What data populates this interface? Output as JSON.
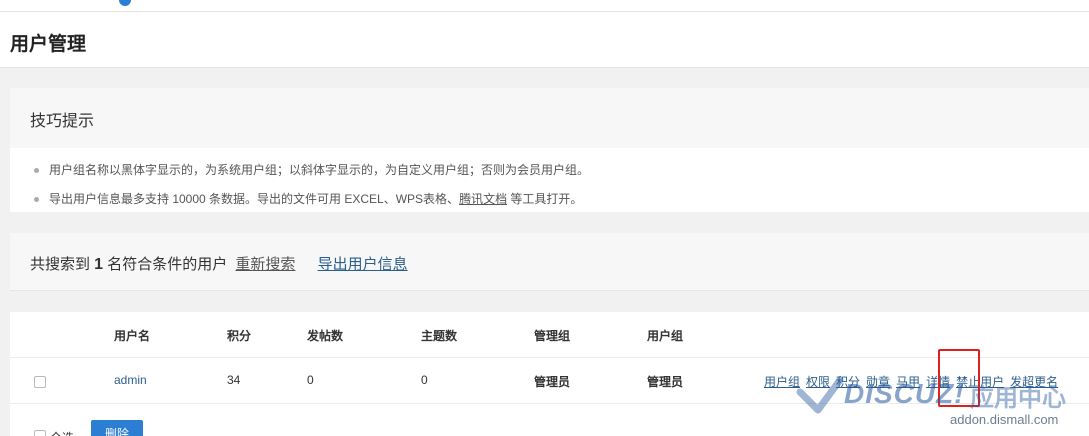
{
  "page": {
    "title": "用户管理"
  },
  "tips": {
    "title": "技巧提示",
    "items": [
      "用户组名称以黑体字显示的，为系统用户组；以斜体字显示的，为自定义用户组；否则为会员用户组。",
      "导出用户信息最多支持 10000 条数据。导出的文件可用 EXCEL、WPS表格、"
    ],
    "item2_link": "腾讯文档",
    "item2_tail": " 等工具打开。"
  },
  "result": {
    "prefix": "共搜索到 ",
    "count": "1",
    "suffix": " 名符合条件的用户",
    "research_link": "重新搜索",
    "export_link": "导出用户信息"
  },
  "table": {
    "headers": {
      "username": "用户名",
      "credits": "积分",
      "posts": "发帖数",
      "threads": "主题数",
      "admin_group": "管理组",
      "user_group": "用户组"
    },
    "rows": [
      {
        "username": "admin",
        "credits": "34",
        "posts": "0",
        "threads": "0",
        "admin_group": "管理员",
        "user_group": "管理员",
        "actions": [
          "用户组",
          "权限",
          "积分",
          "勋章",
          "马甲",
          "详情",
          "禁止用户",
          "发超更名"
        ]
      }
    ]
  },
  "footer": {
    "select_all": "全选",
    "delete_button": "删除"
  },
  "watermark": {
    "logo": "DISCUZ!",
    "cn": "应用中心",
    "url": "addon.dismall.com"
  },
  "colors": {
    "accent": "#2b7ed1",
    "link": "#2b5e8c",
    "highlight": "#e02020"
  }
}
